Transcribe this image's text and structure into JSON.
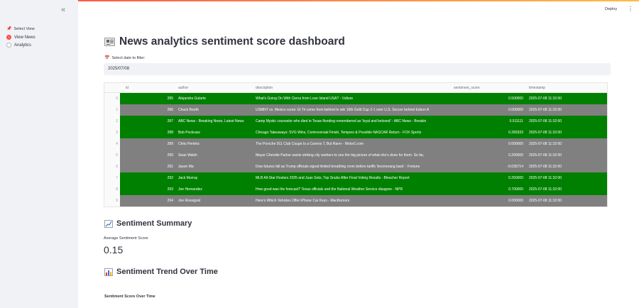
{
  "sidebar": {
    "select_view_label": "Select View",
    "options": [
      {
        "label": "View News",
        "selected": true
      },
      {
        "label": "Analytics",
        "selected": false
      }
    ]
  },
  "header": {
    "deploy_label": "Deploy",
    "menu_icon": "vertical-dots-icon"
  },
  "title": "News analytics sentiment score dashboard",
  "date_filter": {
    "label": "Select date to filter:",
    "value": "2025/07/08"
  },
  "table": {
    "columns": [
      "id",
      "author",
      "description",
      "sentiment_score",
      "timestamp"
    ],
    "rows": [
      {
        "idx": "0",
        "id": "285",
        "author": "Alejandra Gularte",
        "description": "What's Going On With Cierra from Love Island USA? - Vulture",
        "score": "0.500000",
        "timestamp": "2025-07-08 11:32:00",
        "color": "#008000"
      },
      {
        "idx": "1",
        "id": "286",
        "author": "Chuck Booth",
        "description": "USMNT vs. Mexico score: El Tri come from behind to win 10th Gold Cup 2-1 over U.S. Soccer behind Edson A",
        "score": "0.000000",
        "timestamp": "2025-07-08 11:32:00",
        "color": "#808080"
      },
      {
        "idx": "2",
        "id": "287",
        "author": "ABC News - Breaking News, Latest News",
        "description": "Camp Mystic counselor who died in Texas flooding remembered as 'loyal and beloved' - ABC News - Breakin",
        "score": "0.511111",
        "timestamp": "2025-07-08 11:32:00",
        "color": "#008000"
      },
      {
        "idx": "3",
        "id": "288",
        "author": "Bob Pockrass",
        "description": "Chicago Takeaways: SVG Wins, Controversial Finish, Tempers & Possible NASCAR Return - FOX Sports",
        "score": "0.283333",
        "timestamp": "2025-07-08 11:32:00",
        "color": "#008000"
      },
      {
        "idx": "4",
        "id": "289",
        "author": "Chris Perkins",
        "description": "The Porsche 911 Club Coupe Is a Carrera T, But Rarer - Motor1.com",
        "score": "0.000000",
        "timestamp": "2025-07-08 11:32:00",
        "color": "#808080"
      },
      {
        "idx": "5",
        "id": "290",
        "author": "Sean Walsh",
        "description": "Mayor Cherelle Parker wants striking city workers to see the big picture of what she's done for them. So far,",
        "score": "0.200000",
        "timestamp": "2025-07-08 11:32:00",
        "color": "#808080"
      },
      {
        "idx": "6",
        "id": "291",
        "author": "Jason Ma",
        "description": "Dow futures fall as Trump officials signal limited breathing room before tariffs 'boomerang back' - Fortune",
        "score": "-0.035714",
        "timestamp": "2025-07-08 11:32:00",
        "color": "#808080"
      },
      {
        "idx": "7",
        "id": "292",
        "author": "Jack Murray",
        "description": "MLB All-Star Rosters 2025 and Juan Soto, Top Snubs After Final Voting Results - Bleacher Report",
        "score": "0.250000",
        "timestamp": "2025-07-08 11:32:00",
        "color": "#008000"
      },
      {
        "idx": "8",
        "id": "293",
        "author": "Joe Hernandez",
        "description": "How good was the forecast? Texas officials and the National Weather Service disagree - NPR",
        "score": "0.700000",
        "timestamp": "2025-07-08 11:32:00",
        "color": "#008000"
      },
      {
        "idx": "9",
        "id": "294",
        "author": "Joe Rossignol",
        "description": "Here's Which Vehicles Offer iPhone Car Keys - MacRumors",
        "score": "0.000000",
        "timestamp": "2025-07-08 11:32:00",
        "color": "#808080"
      }
    ]
  },
  "summary": {
    "heading": "Sentiment Summary",
    "metric_label": "Average Sentiment Score",
    "metric_value": "0.15"
  },
  "trend": {
    "heading": "Sentiment Trend Over Time",
    "chart_title": "Sentiment Score Over Time"
  }
}
